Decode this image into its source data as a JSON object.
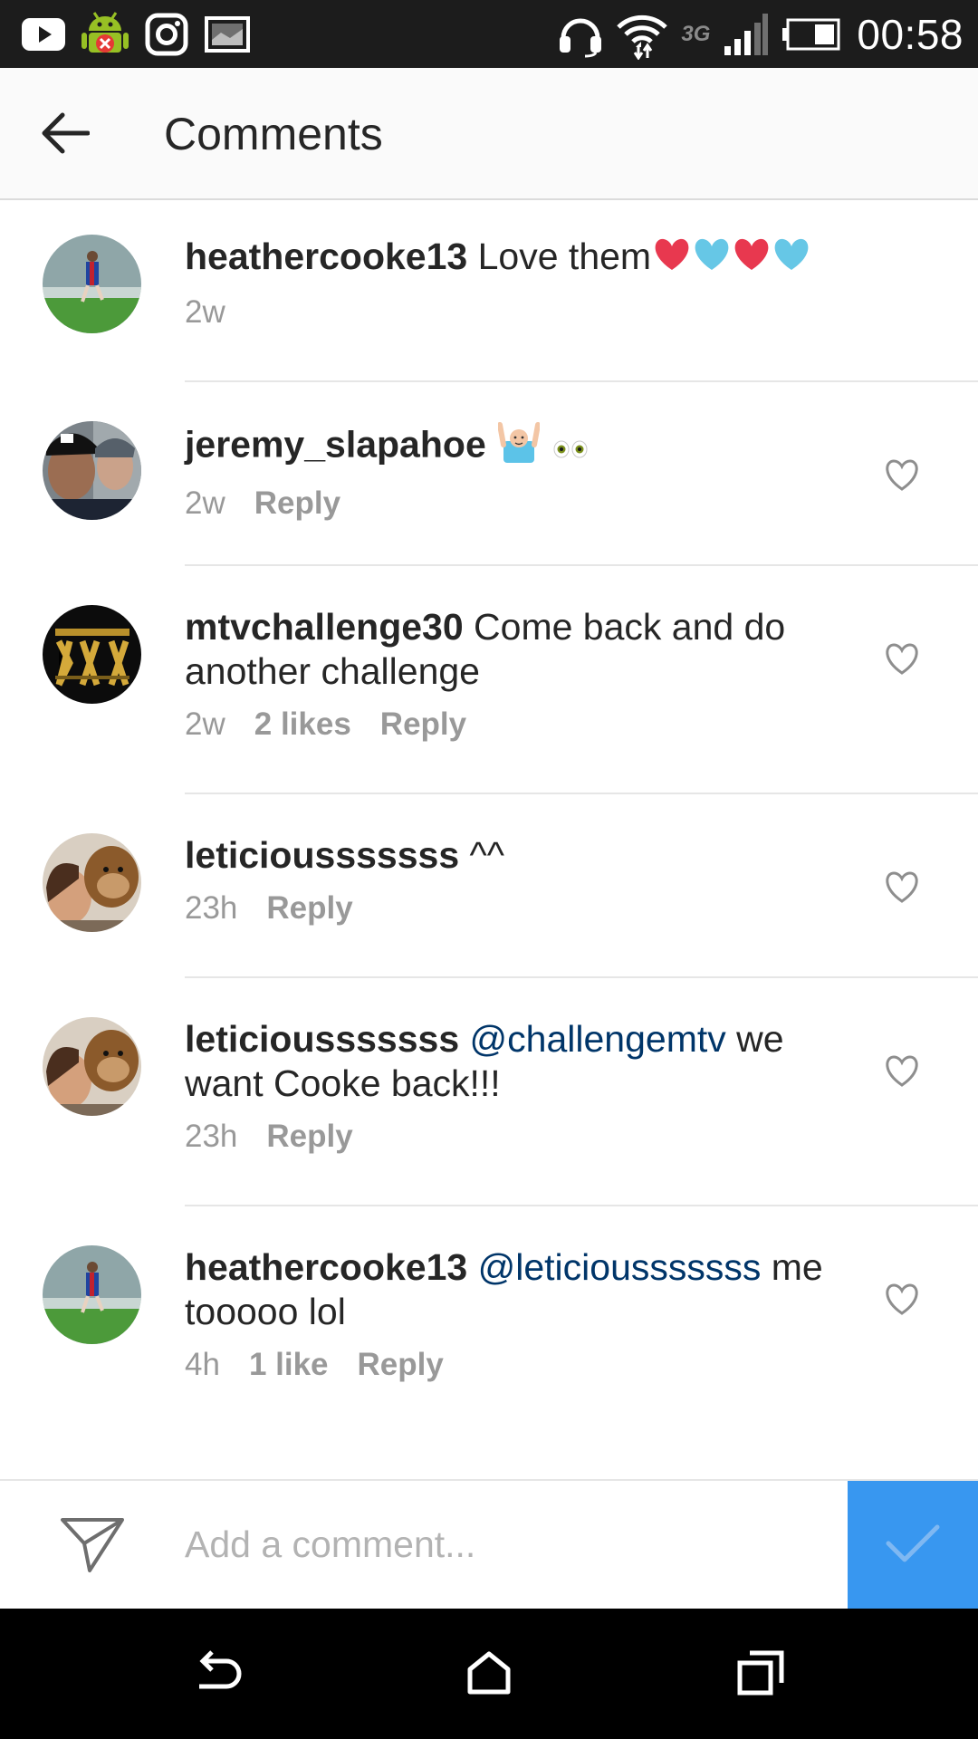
{
  "status_bar": {
    "time": "00:58",
    "network_type": "3G",
    "left_icons": [
      "youtube-icon",
      "android-debug-icon",
      "instagram-icon",
      "gallery-icon"
    ],
    "right_icons": [
      "headset-icon",
      "wifi-icon",
      "signal-icon",
      "battery-icon"
    ]
  },
  "header": {
    "title": "Comments",
    "back_icon": "arrow-left-icon"
  },
  "comments": [
    {
      "username": "heathercooke13",
      "text": "Love them",
      "emojis": [
        "red-heart",
        "blue-heart",
        "red-heart",
        "blue-heart"
      ],
      "time": "2w",
      "likes": "",
      "reply": "",
      "likeable": false
    },
    {
      "username": "jeremy_slapahoe",
      "text": "",
      "emojis": [
        "raising-hands-person",
        "eyes"
      ],
      "time": "2w",
      "likes": "",
      "reply": "Reply",
      "likeable": true
    },
    {
      "username": "mtvchallenge30",
      "text": "Come back and do another challenge",
      "emojis": [],
      "time": "2w",
      "likes": "2 likes",
      "reply": "Reply",
      "likeable": true
    },
    {
      "username": "leticiousssssss",
      "text": "^^",
      "emojis": [],
      "time": "23h",
      "likes": "",
      "reply": "Reply",
      "likeable": true
    },
    {
      "username": "leticiousssssss",
      "mention": "@challengemtv",
      "text": "we want Cooke back!!!",
      "emojis": [],
      "time": "23h",
      "likes": "",
      "reply": "Reply",
      "likeable": true
    },
    {
      "username": "heathercooke13",
      "mention": "@leticiousssssss",
      "text": "me tooooo lol",
      "emojis": [],
      "time": "4h",
      "likes": "1 like",
      "reply": "Reply",
      "likeable": true
    }
  ],
  "compose": {
    "placeholder": "Add a comment...",
    "value": "",
    "direct_icon": "paper-plane-icon",
    "post_icon": "checkmark-icon",
    "accent_color": "#3897f0"
  },
  "colors": {
    "mention": "#003569",
    "meta": "#999999",
    "status_bar_bg": "#1c1c1c"
  },
  "nav_bar": {
    "icons": [
      "back-nav-icon",
      "home-nav-icon",
      "recents-nav-icon"
    ]
  }
}
